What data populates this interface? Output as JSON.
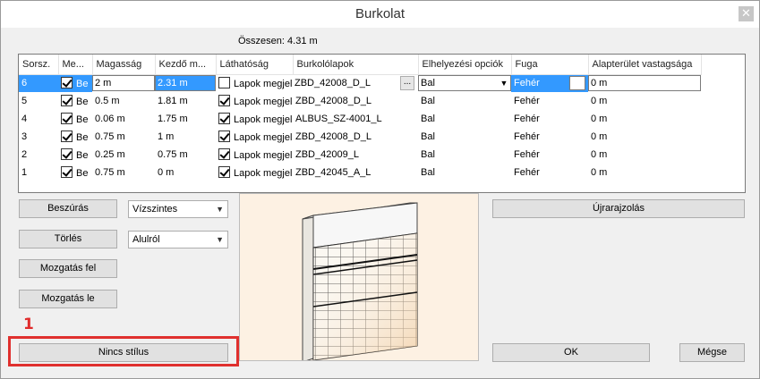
{
  "window": {
    "title": "Burkolat",
    "close_icon": "close-icon"
  },
  "summary": {
    "total_label": "Összesen: 4.31 m"
  },
  "table": {
    "headers": [
      "Sorsz.",
      "Me...",
      "Magasság",
      "Kezdő m...",
      "Láthatóság",
      "Burkolólapok",
      "Elhelyezési opciók",
      "Fuga",
      "Alapterület vastagsága"
    ],
    "selected": {
      "index": "6",
      "visible": "Be",
      "height": "2 m",
      "start": "2.31 m",
      "visibility": "Lapok megjel",
      "tiles": "ZBD_42008_D_L",
      "ellipsis": "...",
      "placement": "Bal",
      "joint": "Fehér",
      "thickness": "0 m"
    },
    "rows": [
      {
        "index": "5",
        "visible": "Be",
        "height": "0.5 m",
        "start": "1.81 m",
        "visibility": "Lapok megjel",
        "tiles": "ZBD_42008_D_L",
        "placement": "Bal",
        "joint": "Fehér",
        "thickness": "0 m"
      },
      {
        "index": "4",
        "visible": "Be",
        "height": "0.06 m",
        "start": "1.75 m",
        "visibility": "Lapok megjel",
        "tiles": "ALBUS_SZ-4001_L",
        "placement": "Bal",
        "joint": "Fehér",
        "thickness": "0 m"
      },
      {
        "index": "3",
        "visible": "Be",
        "height": "0.75 m",
        "start": "1 m",
        "visibility": "Lapok megjel",
        "tiles": "ZBD_42008_D_L",
        "placement": "Bal",
        "joint": "Fehér",
        "thickness": "0 m"
      },
      {
        "index": "2",
        "visible": "Be",
        "height": "0.25 m",
        "start": "0.75 m",
        "visibility": "Lapok megjel",
        "tiles": "ZBD_42009_L",
        "placement": "Bal",
        "joint": "Fehér",
        "thickness": "0 m"
      },
      {
        "index": "1",
        "visible": "Be",
        "height": "0.75 m",
        "start": "0 m",
        "visibility": "Lapok megjel",
        "tiles": "ZBD_42045_A_L",
        "placement": "Bal",
        "joint": "Fehér",
        "thickness": "0 m"
      }
    ]
  },
  "buttons": {
    "insert": "Beszúrás",
    "delete": "Törlés",
    "move_up": "Mozgatás fel",
    "move_down": "Mozgatás le",
    "no_style": "Nincs stílus",
    "redraw": "Újrarajzolás",
    "ok": "OK",
    "cancel": "Mégse"
  },
  "combos": {
    "orientation": "Vízszintes",
    "direction": "Alulról"
  },
  "annotation": {
    "number": "1",
    "color": "#e0302e"
  },
  "colors": {
    "selection": "#3399ff",
    "preview_bg": "#fdf1e3"
  }
}
